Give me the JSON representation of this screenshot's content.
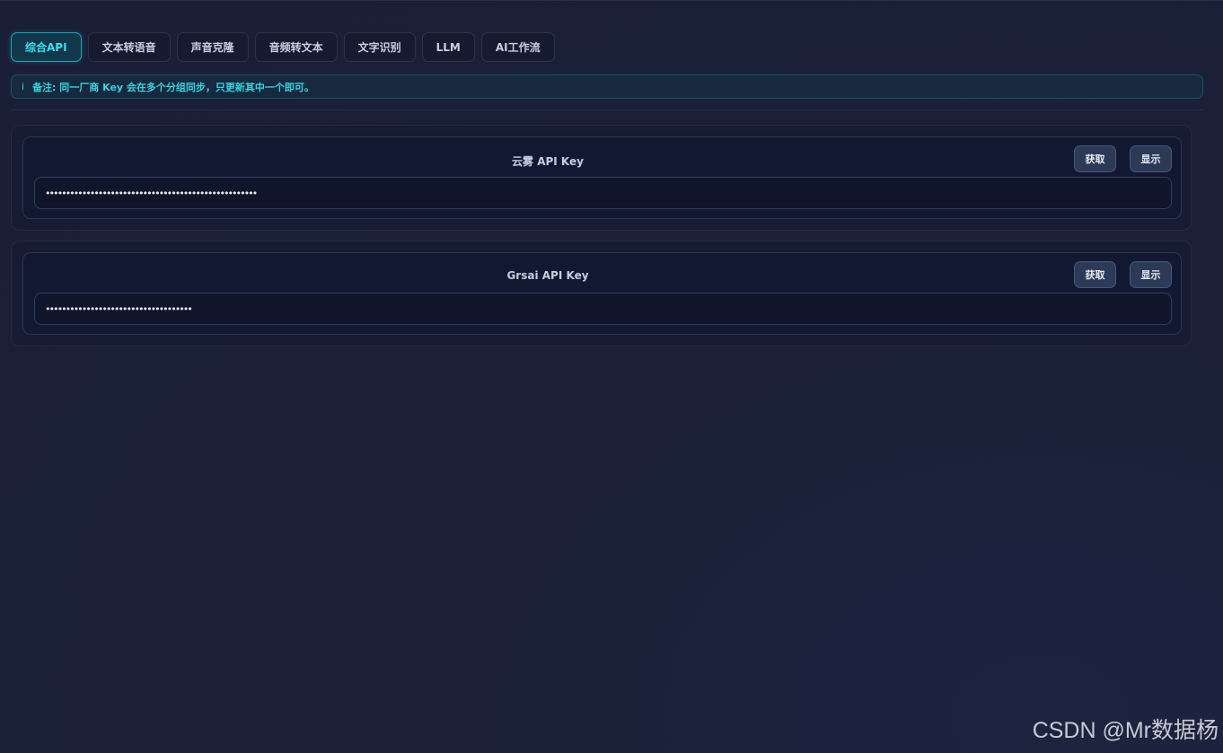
{
  "tabs": [
    {
      "label": "综合API",
      "active": true
    },
    {
      "label": "文本转语音",
      "active": false
    },
    {
      "label": "声音克隆",
      "active": false
    },
    {
      "label": "音频转文本",
      "active": false
    },
    {
      "label": "文字识别",
      "active": false
    },
    {
      "label": "LLM",
      "active": false
    },
    {
      "label": "AI工作流",
      "active": false
    }
  ],
  "notice": {
    "icon": "info-icon",
    "icon_glyph": "i",
    "text": "备注: 同一厂商 Key 会在多个分组同步，只更新其中一个即可。"
  },
  "api_keys": [
    {
      "title": "云雾 API Key",
      "get_label": "获取",
      "show_label": "显示",
      "value": "••••••••••••••••••••••••••••••••••••••••••••••••••••"
    },
    {
      "title": "Grsai API Key",
      "get_label": "获取",
      "show_label": "显示",
      "value": "••••••••••••••••••••••••••••••••••••"
    }
  ],
  "watermark": "CSDN @Mr数据杨",
  "colors": {
    "background": "#1b2038",
    "accent": "#38e0ee",
    "button": "#2d3a57"
  }
}
